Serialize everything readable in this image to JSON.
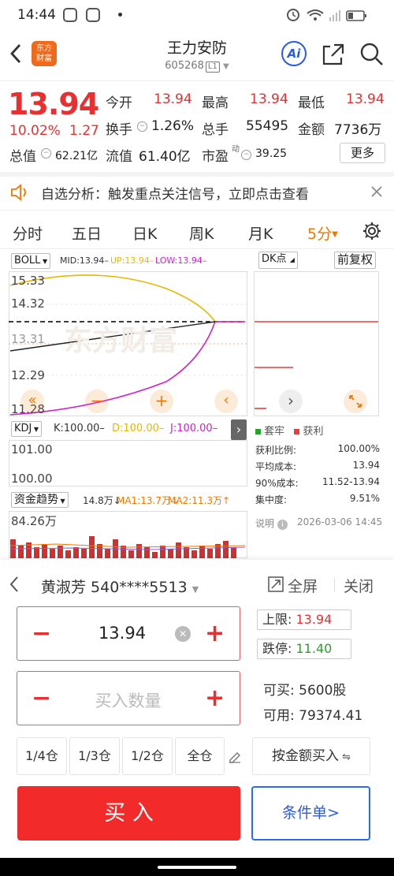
{
  "status_bar": {
    "time": "14:44"
  },
  "header": {
    "logo_text": "东方财富",
    "title": "王力安防",
    "code": "605268",
    "level": "L1",
    "ai_label": "Ai"
  },
  "quote": {
    "price": "13.94",
    "change_pct": "10.02%",
    "change": "1.27",
    "open_label": "今开",
    "open": "13.94",
    "high_label": "最高",
    "high": "13.94",
    "low_label": "最低",
    "low": "13.94",
    "turnover_label": "换手",
    "turnover": "1.26%",
    "volume_label": "总手",
    "volume": "55495",
    "amount_label": "金额",
    "amount": "7736万",
    "mktcap_label": "总值",
    "mktcap": "62.21亿",
    "float_label": "流值",
    "float": "61.40亿",
    "pe_label": "市盈",
    "pe_sup": "动",
    "pe": "39.25",
    "more_label": "更多"
  },
  "alert": {
    "text": "自选分析：触发重点关注信号，立即点击查看"
  },
  "tabs": [
    "分时",
    "五日",
    "日K",
    "周K",
    "月K",
    "5分"
  ],
  "boll": {
    "label": "BOLL",
    "mid": "MID:13.94–",
    "up": "UP:13.94–",
    "low": "LOW:13.94–",
    "y_labels": [
      "15.33",
      "14.32",
      "13.31",
      "12.29",
      "11.28"
    ]
  },
  "dk": {
    "label": "DK点",
    "fq": "前复权"
  },
  "kdj": {
    "label": "KDJ",
    "k": "K:100.00–",
    "d": "D:100.00–",
    "j": "J:100.00–",
    "y_labels": [
      "101.00",
      "100.00"
    ]
  },
  "fund": {
    "label": "资金趋势",
    "v": "14.8万↓",
    "ma1": "MA1:13.7万↓",
    "ma2": "MA2:11.3万↑",
    "y_label": "84.26万"
  },
  "chip": {
    "legend_trapped": "套牢",
    "legend_profit": "获利",
    "rows": [
      {
        "label": "获利比例:",
        "value": "100.00%"
      },
      {
        "label": "平均成本:",
        "value": "13.94"
      },
      {
        "label": "90%成本:",
        "value": "11.52-13.94"
      },
      {
        "label": "集中度:",
        "value": "9.51%"
      }
    ],
    "note": "说明",
    "date": "2026-03-06 14:45"
  },
  "trade": {
    "account": "黄淑芳 540****5513",
    "fullscreen": "全屏",
    "close": "关闭",
    "price_value": "13.94",
    "qty_placeholder": "买入数量",
    "upper_label": "上限:",
    "upper": "13.94",
    "lower_label": "跌停:",
    "lower": "11.40",
    "can_buy_label": "可买:",
    "can_buy": "5600股",
    "available_label": "可用:",
    "available": "79374.41",
    "positions": [
      "1/4仓",
      "1/3仓",
      "1/2仓",
      "全仓"
    ],
    "by_amount": "按金额买入",
    "buy": "买 入",
    "conditional": "条件单>"
  },
  "colors": {
    "up_red": "#e93030",
    "boll_up": "#e8b800",
    "boll_low": "#d020d0",
    "accent_orange": "#f07800",
    "accent_blue": "#2a5be8",
    "profit_green": "#2ca02c"
  }
}
